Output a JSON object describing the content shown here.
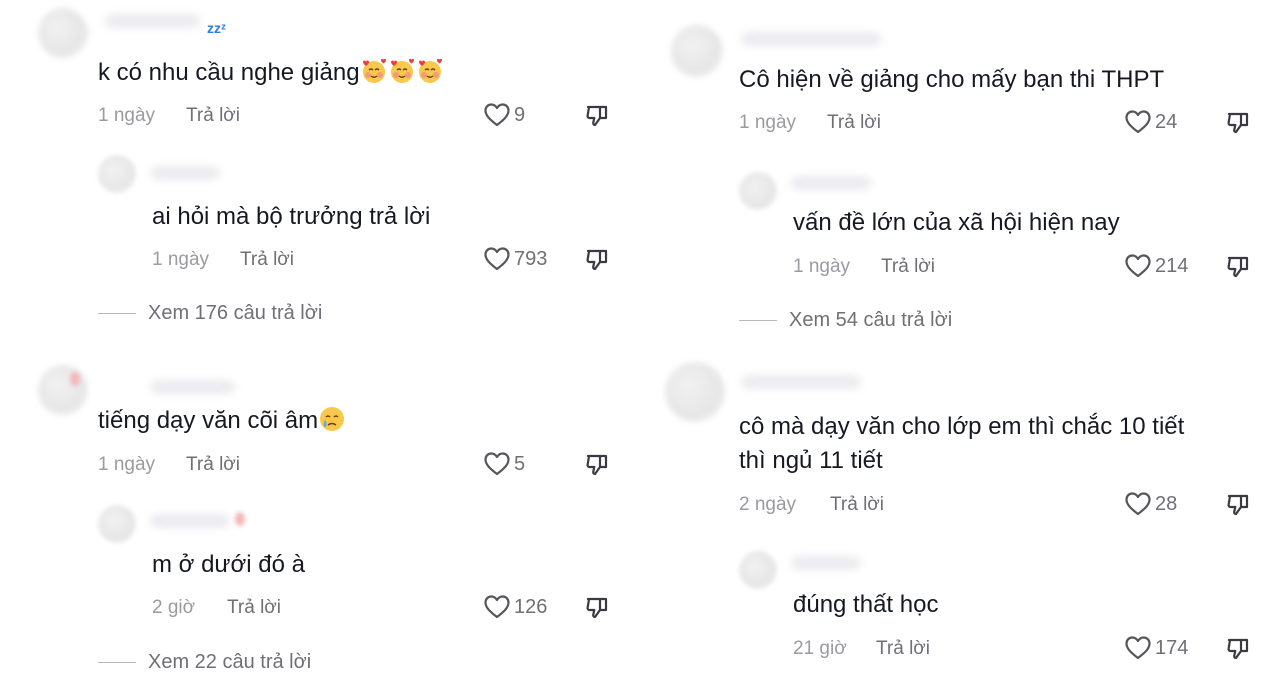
{
  "left": {
    "comments": [
      {
        "text": "k có nhu cầu nghe giảng",
        "time": "1 ngày",
        "reply": "Trả lời",
        "likes": "9",
        "emoji": "smiling-face-with-hearts-emoji"
      },
      {
        "text": "ai hỏi mà bộ trưởng trả lời",
        "time": "1 ngày",
        "reply": "Trả lời",
        "likes": "793"
      },
      {
        "text": "tiếng dạy văn cõi âm",
        "time": "1 ngày",
        "reply": "Trả lời",
        "likes": "5",
        "emoji": "crying-face-emoji"
      },
      {
        "text": "m ở dưới đó à",
        "time": "2 giờ",
        "reply": "Trả lời",
        "likes": "126"
      }
    ],
    "view_replies": [
      "Xem 176 câu trả lời",
      "Xem 22 câu trả lời"
    ],
    "zzz": "zzᶻ"
  },
  "right": {
    "comments": [
      {
        "text": "Cô hiện về giảng cho mấy bạn thi THPT",
        "time": "1 ngày",
        "reply": "Trả lời",
        "likes": "24"
      },
      {
        "text": "vấn đề lớn của xã hội hiện nay",
        "time": "1 ngày",
        "reply": "Trả lời",
        "likes": "214"
      },
      {
        "text_line1": "cô mà dạy văn cho lớp em thì chắc 10 tiết",
        "text_line2": "thì ngủ 11 tiết",
        "time": "2 ngày",
        "reply": "Trả lời",
        "likes": "28"
      },
      {
        "text": "đúng thất học",
        "time": "21 giờ",
        "reply": "Trả lời",
        "likes": "174"
      }
    ],
    "view_replies": [
      "Xem 54 câu trả lời"
    ]
  },
  "colors": {
    "text": "#161823",
    "muted": "#9a9aa0",
    "action": "#6f6f76",
    "zzz": "#2a7de1"
  }
}
